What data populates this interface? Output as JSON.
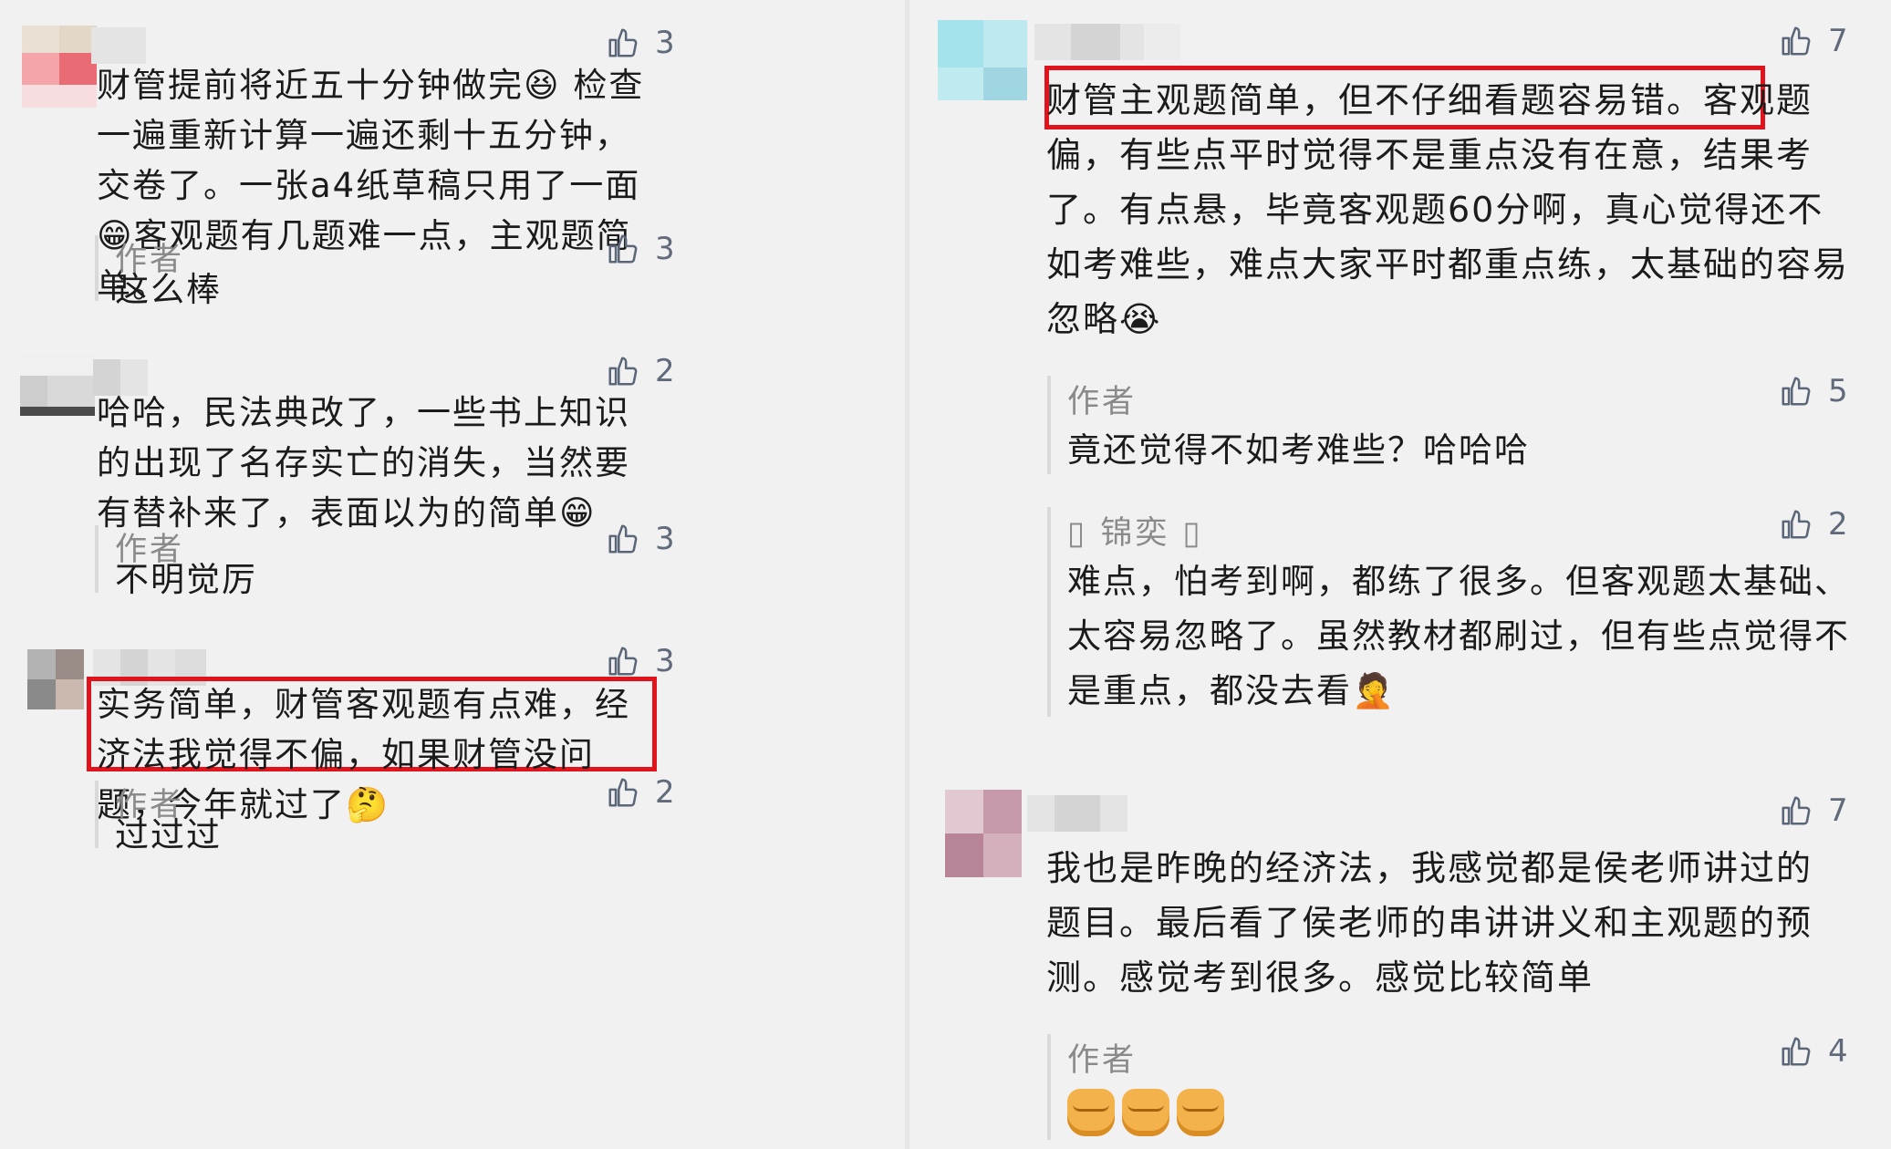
{
  "left": {
    "comments": [
      {
        "likes": "3",
        "text": "财管提前将近五十分钟做完😆 检查一遍重新计算一遍还剩十五分钟，交卷了。一张a4纸草稿只用了一面😁客观题有几题难一点，主观题简单。",
        "reply": {
          "author": "作者",
          "text": "这么棒",
          "likes": "3"
        }
      },
      {
        "likes": "2",
        "text": "哈哈，民法典改了，一些书上知识的出现了名存实亡的消失，当然要有替补来了，表面以为的简单😁",
        "reply": {
          "author": "作者",
          "text": "不明觉厉",
          "likes": "3"
        }
      },
      {
        "likes": "3",
        "text": "实务简单，财管客观题有点难，经济法我觉得不偏，如果财管没问题，今年就过了🤔",
        "reply": {
          "author": "作者",
          "text": "过过过",
          "likes": "2"
        }
      }
    ]
  },
  "right": {
    "comments": [
      {
        "likes": "7",
        "text_highlight": "财管主观题简单，但不仔细看题容易错。",
        "text_rest": "客观题偏，有些点平时觉得不是重点没有在意，结果考了。有点悬，毕竟客观题60分啊，真心觉得还不如考难些，难点大家平时都重点练，太基础的容易忽略😭",
        "replies": [
          {
            "author": "作者",
            "text": "竟还觉得不如考难些？哈哈哈",
            "likes": "5"
          },
          {
            "author": "▯ 锦奕 ▯",
            "text": "难点，怕考到啊，都练了很多。但客观题太基础、太容易忽略了。虽然教材都刷过，但有些点觉得不是重点，都没去看🤦",
            "likes": "2"
          }
        ]
      },
      {
        "likes": "7",
        "text": "我也是昨晚的经济法，我感觉都是侯老师讲过的题目。最后看了侯老师的串讲讲义和主观题的预测。感觉考到很多。感觉比较简单",
        "reply": {
          "author": "作者",
          "text": "✊✊✊",
          "likes": "4"
        }
      }
    ]
  },
  "colors": {
    "highlight_border": "#e0141c",
    "like_icon": "#606a7a",
    "background": "#f2f2f2"
  },
  "icons": {
    "like": "thumbs-up-icon"
  }
}
